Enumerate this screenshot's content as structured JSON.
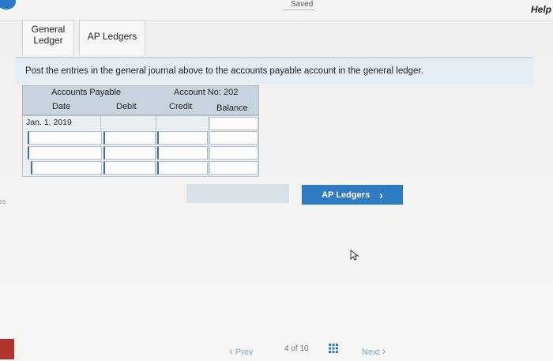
{
  "topbar": {
    "saved_label": "Saved",
    "help_label": "Help"
  },
  "tabs": [
    {
      "label_line1": "General",
      "label_line2": "Ledger"
    },
    {
      "label": "AP Ledgers"
    }
  ],
  "instruction": "Post the entries in the general journal above to the accounts payable account in the general ledger.",
  "ledger": {
    "title": "Accounts Payable",
    "account_no": "Account No: 202",
    "columns": [
      "Date",
      "Debit",
      "Credit",
      "Balance"
    ],
    "first_date": "Jan. 1, 2019"
  },
  "buttons": {
    "ap_ledgers": "AP Ledgers",
    "ap_arrow": "›"
  },
  "side_text": "es",
  "footer": {
    "prev": "Prev",
    "prev_arrow": "‹",
    "page": "4 of 10",
    "next": "Next",
    "next_arrow": "›"
  },
  "colors": {
    "accent": "#2e7bc4",
    "header_bg": "#c7d4de",
    "instruction_bg": "#e4edf3"
  },
  "icons": {
    "grid": "grid-icon",
    "cursor": "mouse-cursor-icon"
  }
}
